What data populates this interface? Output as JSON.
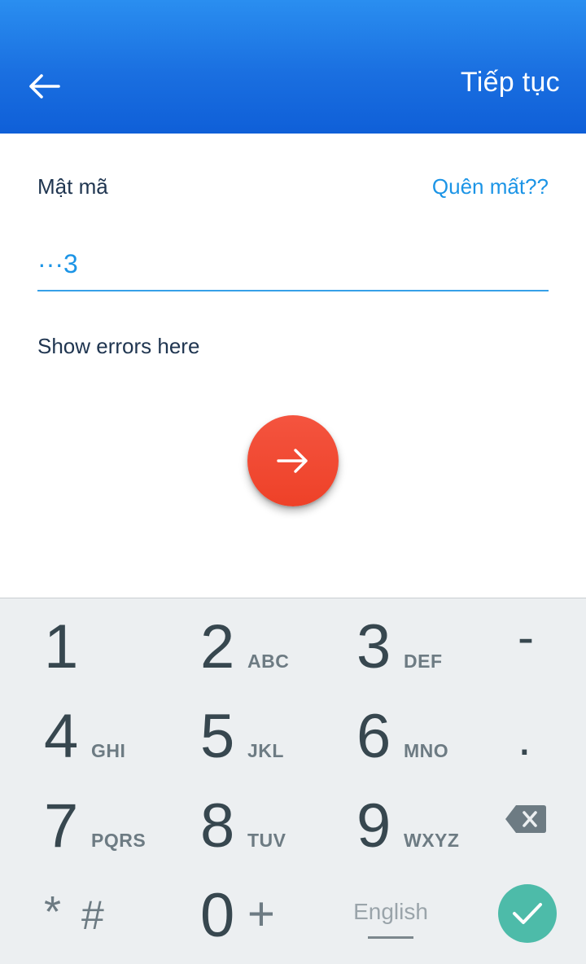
{
  "header": {
    "action_label": "Tiếp tục"
  },
  "form": {
    "label": "Mật mã",
    "forgot_link": "Quên mất??",
    "password_value": "···3",
    "error_text": "Show errors here"
  },
  "keyboard": {
    "keys": [
      {
        "num": "1",
        "letters": ""
      },
      {
        "num": "2",
        "letters": "ABC"
      },
      {
        "num": "3",
        "letters": "DEF"
      },
      {
        "num": "-",
        "letters": ""
      },
      {
        "num": "4",
        "letters": "GHI"
      },
      {
        "num": "5",
        "letters": "JKL"
      },
      {
        "num": "6",
        "letters": "MNO"
      },
      {
        "num": ".",
        "letters": ""
      },
      {
        "num": "7",
        "letters": "PQRS"
      },
      {
        "num": "8",
        "letters": "TUV"
      },
      {
        "num": "9",
        "letters": "WXYZ"
      },
      {
        "num": "*",
        "letters": "#"
      },
      {
        "num": "0",
        "letters": "+"
      }
    ],
    "language": "English"
  },
  "colors": {
    "header_top": "#2a8ef0",
    "header_bottom": "#0f5fd8",
    "accent_link": "#1b94e6",
    "fab": "#f04a33",
    "keyboard_bg": "#eceff1",
    "done_button": "#4dbba9"
  },
  "icons": {
    "back": "arrow-left-icon",
    "fab": "arrow-right-icon",
    "backspace": "backspace-icon",
    "done": "check-icon"
  }
}
